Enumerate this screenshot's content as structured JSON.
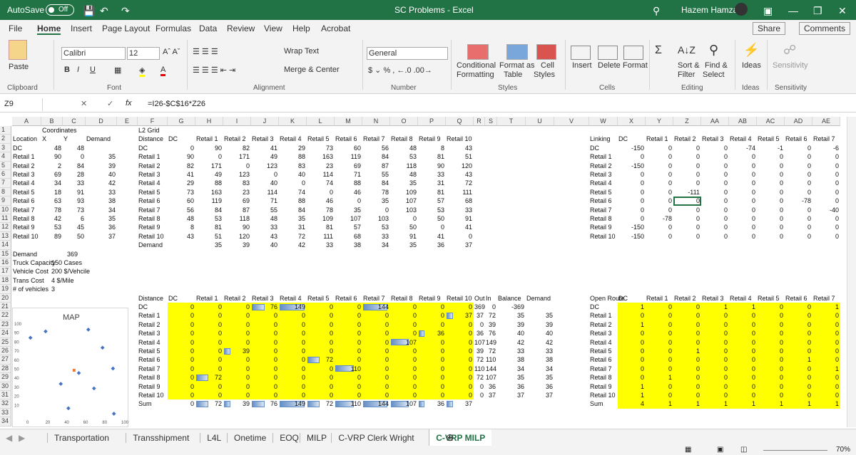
{
  "titlebar": {
    "autosave": "AutoSave",
    "toggle": "Off",
    "title": "SC Problems  -  Excel",
    "user": "Hazem Hamza"
  },
  "menu": [
    "File",
    "Home",
    "Insert",
    "Page Layout",
    "Formulas",
    "Data",
    "Review",
    "View",
    "Help",
    "Acrobat"
  ],
  "share": "Share",
  "comments": "Comments",
  "ribbon": {
    "font_name": "Calibri",
    "font_size": "12",
    "wrap": "Wrap Text",
    "merge": "Merge & Center",
    "number_format": "General",
    "cond": "Conditional",
    "formatting": "Formatting",
    "format_as": "Format as",
    "table": "Table",
    "cell": "Cell",
    "styles": "Styles",
    "insert": "Insert",
    "delete": "Delete",
    "format": "Format",
    "sort": "Sort &",
    "filter": "Filter",
    "find": "Find &",
    "select": "Select",
    "ideas": "Ideas",
    "sensitivity": "Sensitivity",
    "paste": "Paste",
    "groups": [
      "Clipboard",
      "Font",
      "Alignment",
      "Number",
      "Styles",
      "Cells",
      "Editing",
      "Ideas",
      "Sensitivity"
    ]
  },
  "namebox": "Z9",
  "fx": "fx",
  "formula": "=I26-$C$16*Z26",
  "columns": [
    "A",
    "B",
    "C",
    "D",
    "E",
    "F",
    "G",
    "H",
    "I",
    "J",
    "K",
    "L",
    "M",
    "N",
    "O",
    "P",
    "Q",
    "R",
    "S",
    "T",
    "U",
    "V",
    "W",
    "X",
    "Y",
    "Z",
    "AA",
    "AB",
    "AC",
    "AD",
    "AE"
  ],
  "rows": [
    "1",
    "2",
    "3",
    "4",
    "5",
    "6",
    "7",
    "8",
    "9",
    "10",
    "11",
    "12",
    "13",
    "14",
    "15",
    "16",
    "17",
    "18",
    "19",
    "20",
    "21",
    "22",
    "23",
    "24",
    "25",
    "26",
    "27",
    "28",
    "29",
    "30",
    "31",
    "32",
    "33",
    "34"
  ],
  "left": {
    "coordinates": "Coordinates",
    "l2grid": "L2 Grid",
    "hdr": [
      "Location",
      "X",
      "Y",
      "Demand"
    ],
    "locs": [
      [
        "DC",
        "48",
        "48",
        ""
      ],
      [
        "Retail 1",
        "90",
        "0",
        "35"
      ],
      [
        "Retail 2",
        "2",
        "84",
        "39"
      ],
      [
        "Retail 3",
        "69",
        "28",
        "40"
      ],
      [
        "Retail 4",
        "34",
        "33",
        "42"
      ],
      [
        "Retail 5",
        "18",
        "91",
        "33"
      ],
      [
        "Retail 6",
        "63",
        "93",
        "38"
      ],
      [
        "Retail 7",
        "78",
        "73",
        "34"
      ],
      [
        "Retail 8",
        "42",
        "6",
        "35"
      ],
      [
        "Retail 9",
        "53",
        "45",
        "36"
      ],
      [
        "Retail 10",
        "89",
        "50",
        "37"
      ]
    ],
    "params": [
      [
        "Demand",
        "369"
      ],
      [
        "Truck Capacity",
        "150 Cases"
      ],
      [
        "Vehicle Cost",
        "200 $/Vehcile"
      ],
      [
        "Trans Cost",
        "4 $/Mile"
      ],
      [
        "# of vehicles",
        "3"
      ]
    ]
  },
  "dist": {
    "hdr": [
      "Distance",
      "DC",
      "Retail 1",
      "Retail 2",
      "Retail 3",
      "Retail 4",
      "Retail 5",
      "Retail 6",
      "Retail 7",
      "Retail 8",
      "Retail 9",
      "Retail 10"
    ],
    "rows": [
      [
        "DC",
        "0",
        "90",
        "82",
        "41",
        "29",
        "73",
        "60",
        "56",
        "48",
        "8",
        "43"
      ],
      [
        "Retail 1",
        "90",
        "0",
        "171",
        "49",
        "88",
        "163",
        "119",
        "84",
        "53",
        "81",
        "51"
      ],
      [
        "Retail 2",
        "82",
        "171",
        "0",
        "123",
        "83",
        "23",
        "69",
        "87",
        "118",
        "90",
        "120"
      ],
      [
        "Retail 3",
        "41",
        "49",
        "123",
        "0",
        "40",
        "114",
        "71",
        "55",
        "48",
        "33",
        "43"
      ],
      [
        "Retail 4",
        "29",
        "88",
        "83",
        "40",
        "0",
        "74",
        "88",
        "84",
        "35",
        "31",
        "72"
      ],
      [
        "Retail 5",
        "73",
        "163",
        "23",
        "114",
        "74",
        "0",
        "46",
        "78",
        "109",
        "81",
        "111"
      ],
      [
        "Retail 6",
        "60",
        "119",
        "69",
        "71",
        "88",
        "46",
        "0",
        "35",
        "107",
        "57",
        "68"
      ],
      [
        "Retail 7",
        "56",
        "84",
        "87",
        "55",
        "84",
        "78",
        "35",
        "0",
        "103",
        "53",
        "33"
      ],
      [
        "Retail 8",
        "48",
        "53",
        "118",
        "48",
        "35",
        "109",
        "107",
        "103",
        "0",
        "50",
        "91"
      ],
      [
        "Retail 9",
        "8",
        "81",
        "90",
        "33",
        "31",
        "81",
        "57",
        "53",
        "50",
        "0",
        "41"
      ],
      [
        "Retail 10",
        "43",
        "51",
        "120",
        "43",
        "72",
        "111",
        "68",
        "33",
        "91",
        "41",
        "0"
      ],
      [
        "Demand",
        "",
        "35",
        "39",
        "40",
        "42",
        "33",
        "38",
        "34",
        "35",
        "36",
        "37"
      ]
    ]
  },
  "link": {
    "hdr": [
      "Linking",
      "DC",
      "Retail 1",
      "Retail 2",
      "Retail 3",
      "Retail 4",
      "Retail 5",
      "Retail 6",
      "Retail 7"
    ],
    "rows": [
      [
        "DC",
        "-150",
        "0",
        "0",
        "0",
        "-74",
        "-1",
        "0",
        "-6"
      ],
      [
        "Retail 1",
        "0",
        "0",
        "0",
        "0",
        "0",
        "0",
        "0",
        "0"
      ],
      [
        "Retail 2",
        "-150",
        "0",
        "0",
        "0",
        "0",
        "0",
        "0",
        "0"
      ],
      [
        "Retail 3",
        "0",
        "0",
        "0",
        "0",
        "0",
        "0",
        "0",
        "0"
      ],
      [
        "Retail 4",
        "0",
        "0",
        "0",
        "0",
        "0",
        "0",
        "0",
        "0"
      ],
      [
        "Retail 5",
        "0",
        "0",
        "-111",
        "0",
        "0",
        "0",
        "0",
        "0"
      ],
      [
        "Retail 6",
        "0",
        "0",
        "0",
        "0",
        "0",
        "0",
        "-78",
        "0"
      ],
      [
        "Retail 7",
        "0",
        "0",
        "0",
        "0",
        "0",
        "0",
        "0",
        "-40"
      ],
      [
        "Retail 8",
        "0",
        "-78",
        "0",
        "0",
        "0",
        "0",
        "0",
        "0"
      ],
      [
        "Retail 9",
        "-150",
        "0",
        "0",
        "0",
        "0",
        "0",
        "0",
        "0"
      ],
      [
        "Retail 10",
        "-150",
        "0",
        "0",
        "0",
        "0",
        "0",
        "0",
        "0"
      ]
    ]
  },
  "flow": {
    "hdr": [
      "Distance",
      "DC",
      "Retail 1",
      "Retail 2",
      "Retail 3",
      "Retail 4",
      "Retail 5",
      "Retail 6",
      "Retail 7",
      "Retail 8",
      "Retail 9",
      "Retail 10",
      "Out",
      "In",
      "Balance",
      "Demand"
    ],
    "rows": [
      [
        "DC",
        "0",
        "0",
        "0",
        "76",
        "149",
        "0",
        "0",
        "144",
        "0",
        "0",
        "0",
        "369",
        "0",
        "-369",
        ""
      ],
      [
        "Retail 1",
        "0",
        "0",
        "0",
        "0",
        "0",
        "0",
        "0",
        "0",
        "0",
        "0",
        "37",
        "37",
        "72",
        "35",
        "35"
      ],
      [
        "Retail 2",
        "0",
        "0",
        "0",
        "0",
        "0",
        "0",
        "0",
        "0",
        "0",
        "0",
        "0",
        "0",
        "39",
        "39",
        "39"
      ],
      [
        "Retail 3",
        "0",
        "0",
        "0",
        "0",
        "0",
        "0",
        "0",
        "0",
        "0",
        "36",
        "0",
        "36",
        "76",
        "40",
        "40"
      ],
      [
        "Retail 4",
        "0",
        "0",
        "0",
        "0",
        "0",
        "0",
        "0",
        "0",
        "107",
        "0",
        "0",
        "107",
        "149",
        "42",
        "42"
      ],
      [
        "Retail 5",
        "0",
        "0",
        "39",
        "0",
        "0",
        "0",
        "0",
        "0",
        "0",
        "0",
        "0",
        "39",
        "72",
        "33",
        "33"
      ],
      [
        "Retail 6",
        "0",
        "0",
        "0",
        "0",
        "0",
        "72",
        "0",
        "0",
        "0",
        "0",
        "0",
        "72",
        "110",
        "38",
        "38"
      ],
      [
        "Retail 7",
        "0",
        "0",
        "0",
        "0",
        "0",
        "0",
        "110",
        "0",
        "0",
        "0",
        "0",
        "110",
        "144",
        "34",
        "34"
      ],
      [
        "Retail 8",
        "0",
        "72",
        "0",
        "0",
        "0",
        "0",
        "0",
        "0",
        "0",
        "0",
        "0",
        "72",
        "107",
        "35",
        "35"
      ],
      [
        "Retail 9",
        "0",
        "0",
        "0",
        "0",
        "0",
        "0",
        "0",
        "0",
        "0",
        "0",
        "0",
        "0",
        "36",
        "36",
        "36"
      ],
      [
        "Retail 10",
        "0",
        "0",
        "0",
        "0",
        "0",
        "0",
        "0",
        "0",
        "0",
        "0",
        "0",
        "0",
        "37",
        "37",
        "37"
      ],
      [
        "Sum",
        "0",
        "72",
        "39",
        "76",
        "149",
        "72",
        "110",
        "144",
        "107",
        "36",
        "37",
        "",
        "",
        "",
        ""
      ]
    ]
  },
  "route": {
    "hdr": [
      "Open Route",
      "DC",
      "Retail 1",
      "Retail 2",
      "Retail 3",
      "Retail 4",
      "Retail 5",
      "Retail 6",
      "Retail 7"
    ],
    "rows": [
      [
        "DC",
        "1",
        "0",
        "0",
        "1",
        "1",
        "0",
        "0",
        "1"
      ],
      [
        "Retail 1",
        "0",
        "0",
        "0",
        "0",
        "0",
        "0",
        "0",
        "0"
      ],
      [
        "Retail 2",
        "1",
        "0",
        "0",
        "0",
        "0",
        "0",
        "0",
        "0"
      ],
      [
        "Retail 3",
        "0",
        "0",
        "0",
        "0",
        "0",
        "0",
        "0",
        "0"
      ],
      [
        "Retail 4",
        "0",
        "0",
        "0",
        "0",
        "0",
        "0",
        "0",
        "0"
      ],
      [
        "Retail 5",
        "0",
        "0",
        "1",
        "0",
        "0",
        "0",
        "0",
        "0"
      ],
      [
        "Retail 6",
        "0",
        "0",
        "0",
        "0",
        "0",
        "0",
        "1",
        "0"
      ],
      [
        "Retail 7",
        "0",
        "0",
        "0",
        "0",
        "0",
        "0",
        "0",
        "1"
      ],
      [
        "Retail 8",
        "0",
        "1",
        "0",
        "0",
        "0",
        "0",
        "0",
        "0"
      ],
      [
        "Retail 9",
        "1",
        "0",
        "0",
        "0",
        "0",
        "0",
        "0",
        "0"
      ],
      [
        "Retail 10",
        "1",
        "0",
        "0",
        "0",
        "0",
        "0",
        "0",
        "0"
      ],
      [
        "Sum",
        "4",
        "1",
        "1",
        "1",
        "1",
        "1",
        "1",
        "1"
      ]
    ]
  },
  "chart_data": {
    "type": "scatter",
    "title": "MAP",
    "xlim": [
      0,
      100
    ],
    "ylim": [
      0,
      100
    ],
    "xticks": [
      "0",
      "20",
      "40",
      "60",
      "80",
      "100"
    ],
    "yticks": [
      "10",
      "20",
      "30",
      "40",
      "50",
      "60",
      "70",
      "80",
      "90",
      "100"
    ],
    "series": [
      {
        "name": "Retail",
        "color": "#4472c4",
        "points": [
          [
            90,
            0
          ],
          [
            2,
            84
          ],
          [
            69,
            28
          ],
          [
            34,
            33
          ],
          [
            18,
            91
          ],
          [
            63,
            93
          ],
          [
            78,
            73
          ],
          [
            42,
            6
          ],
          [
            53,
            45
          ],
          [
            89,
            50
          ]
        ]
      },
      {
        "name": "DC",
        "color": "#ed7d31",
        "points": [
          [
            48,
            48
          ]
        ]
      }
    ]
  },
  "sheets": [
    "Transportation",
    "Transshipment",
    "L4L",
    "Onetime",
    "EOQ",
    "MILP",
    "C-VRP Clerk Wright",
    "C-VRP MILP"
  ],
  "active_sheet": "C-VRP MILP",
  "zoom": "70%"
}
